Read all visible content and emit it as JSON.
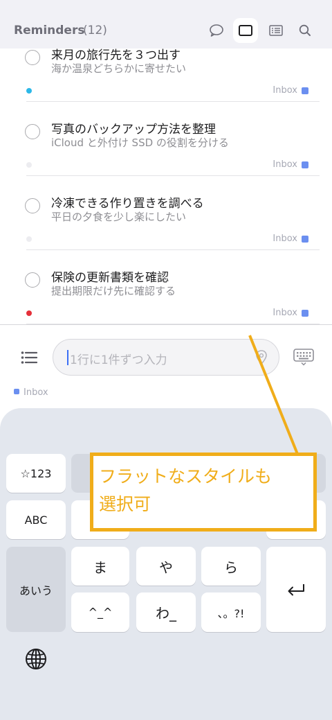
{
  "header": {
    "title": "Reminders",
    "count": "(12)",
    "buttons": [
      {
        "name": "comment-icon",
        "active": false
      },
      {
        "name": "card-view-icon",
        "active": true
      },
      {
        "name": "list-view-icon",
        "active": false
      },
      {
        "name": "search-icon",
        "active": false
      }
    ]
  },
  "reminders": [
    {
      "title": "来月の旅行先を３つ出す",
      "subtitle": "海か温泉どちらかに寄せたい",
      "dot_color": "#2cb8e8",
      "list": "Inbox"
    },
    {
      "title": "写真のバックアップ方法を整理",
      "subtitle": "iCloud と外付け SSD の役割を分ける",
      "dot_color": "#ececf0",
      "list": "Inbox"
    },
    {
      "title": "冷凍できる作り置きを調べる",
      "subtitle": "平日の夕食を少し楽にしたい",
      "dot_color": "#ececf0",
      "list": "Inbox"
    },
    {
      "title": "保険の更新書類を確認",
      "subtitle": "提出期限だけ先に確認する",
      "dot_color": "#e5303a",
      "list": "Inbox"
    }
  ],
  "input": {
    "placeholder": "1行に1件ずつ入力",
    "target_list": "Inbox"
  },
  "keyboard": {
    "symbols_key": "☆123",
    "abc_key": "ABC",
    "kana_key": "あいう",
    "row3": [
      "ま",
      "や",
      "ら"
    ],
    "row4": [
      "^_^",
      "わ_",
      "、。?!"
    ],
    "return_icon": "return-icon",
    "globe_icon": "globe-icon"
  },
  "annotation": {
    "text": "フラットなスタイルも\n選択可",
    "color": "#f0ad1a"
  }
}
